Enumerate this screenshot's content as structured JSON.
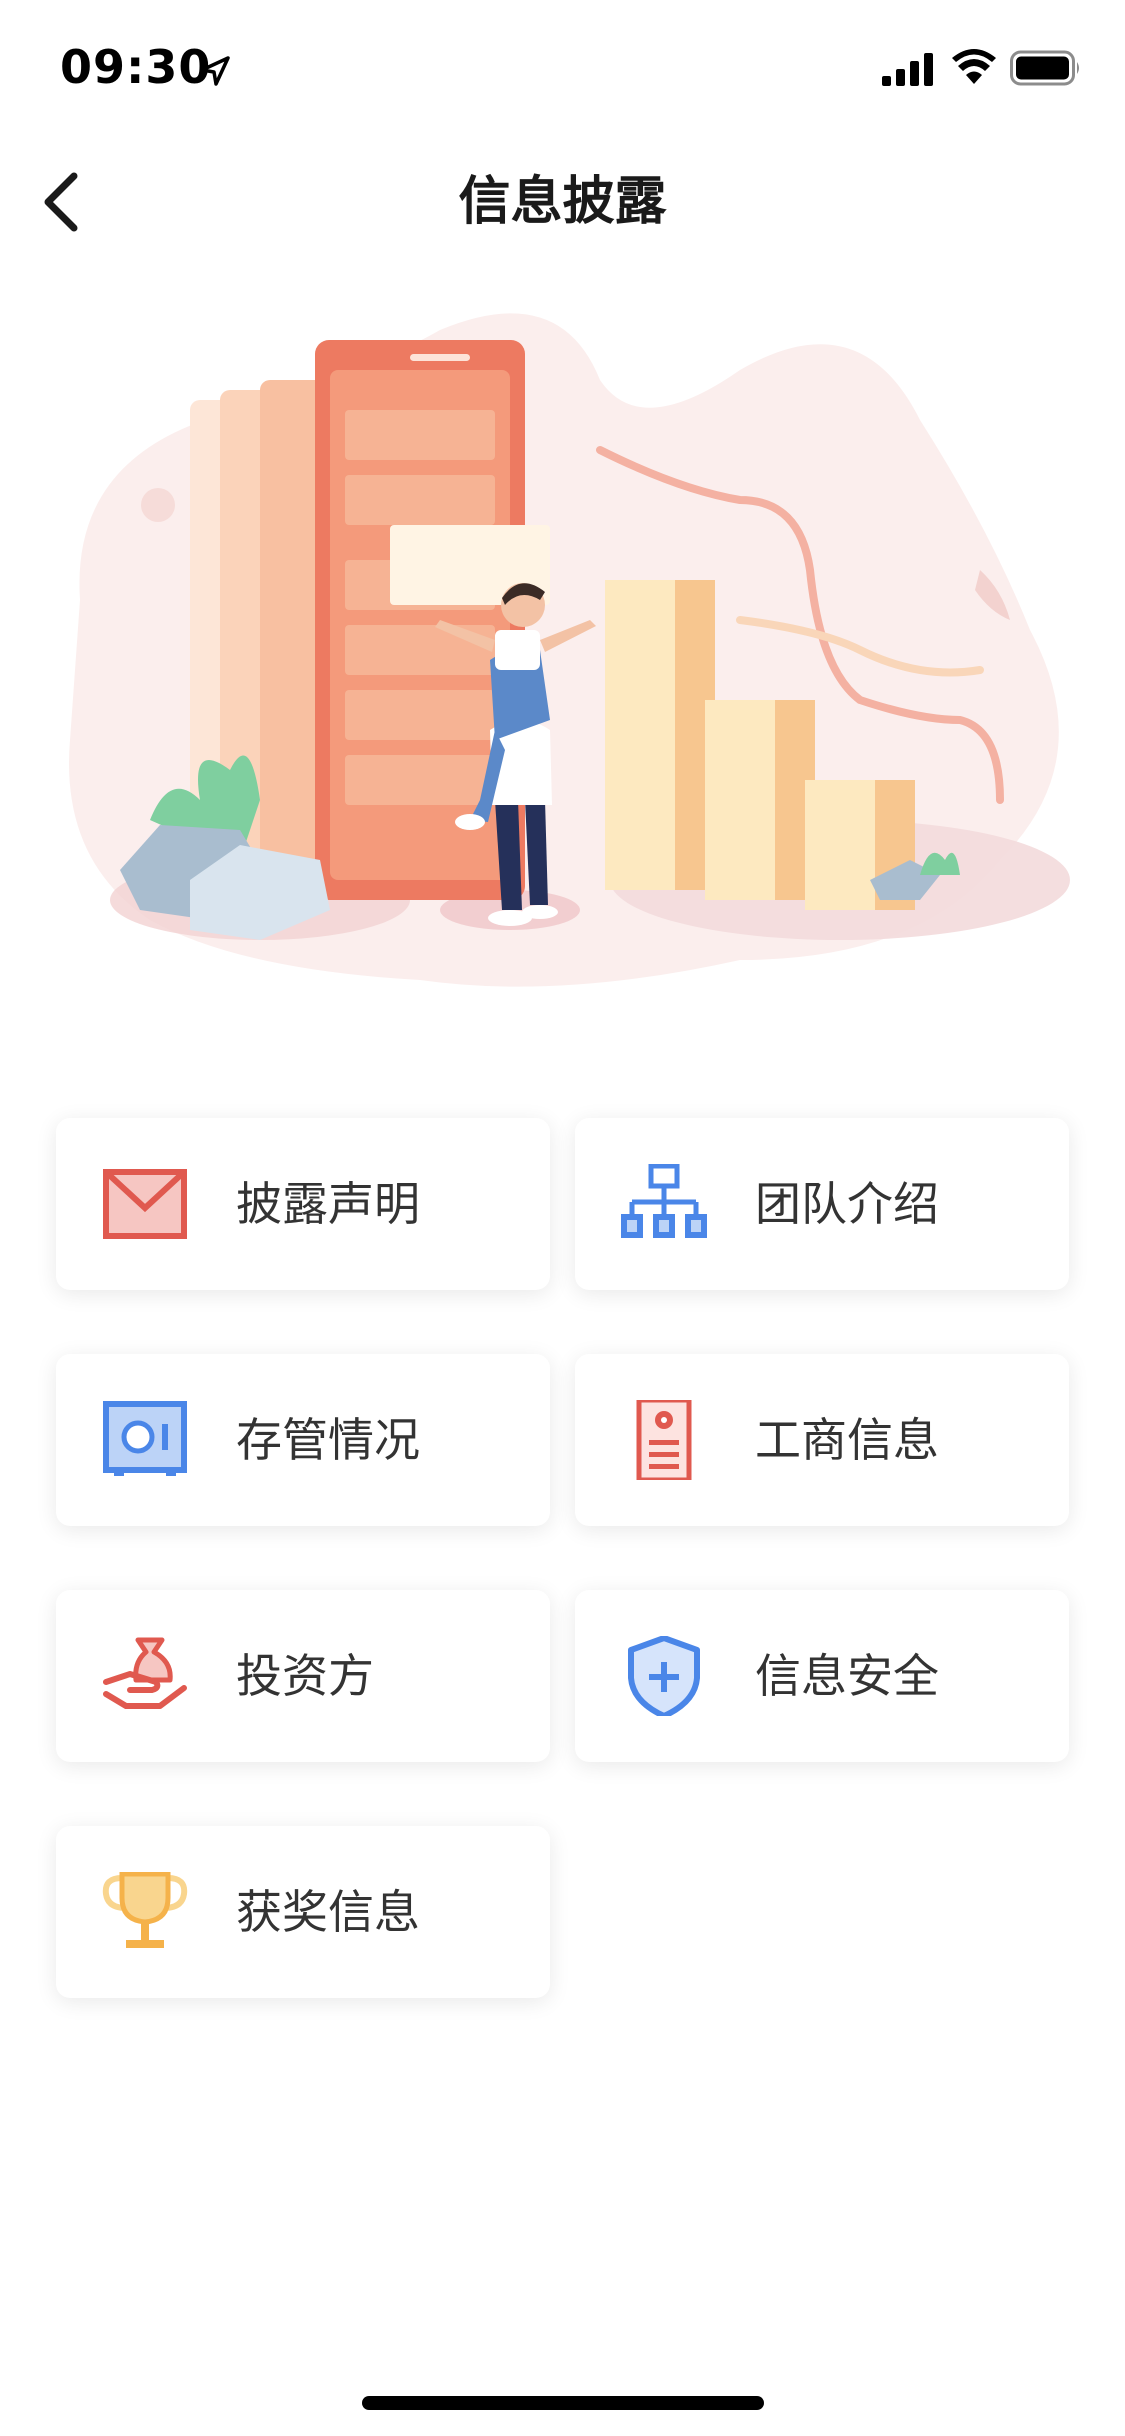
{
  "status_bar": {
    "time": "09:30"
  },
  "nav": {
    "title": "信息披露"
  },
  "menu": {
    "items": [
      {
        "label": "披露声明",
        "icon": "envelope-icon",
        "color": "#e0594f"
      },
      {
        "label": "团队介绍",
        "icon": "org-chart-icon",
        "color": "#4a86e8"
      },
      {
        "label": "存管情况",
        "icon": "safe-icon",
        "color": "#4a86e8"
      },
      {
        "label": "工商信息",
        "icon": "license-icon",
        "color": "#e0594f"
      },
      {
        "label": "投资方",
        "icon": "money-bag-hand-icon",
        "color": "#e0594f"
      },
      {
        "label": "信息安全",
        "icon": "shield-icon",
        "color": "#4a86e8"
      },
      {
        "label": "获奖信息",
        "icon": "trophy-icon",
        "color": "#f5b24a"
      }
    ]
  }
}
